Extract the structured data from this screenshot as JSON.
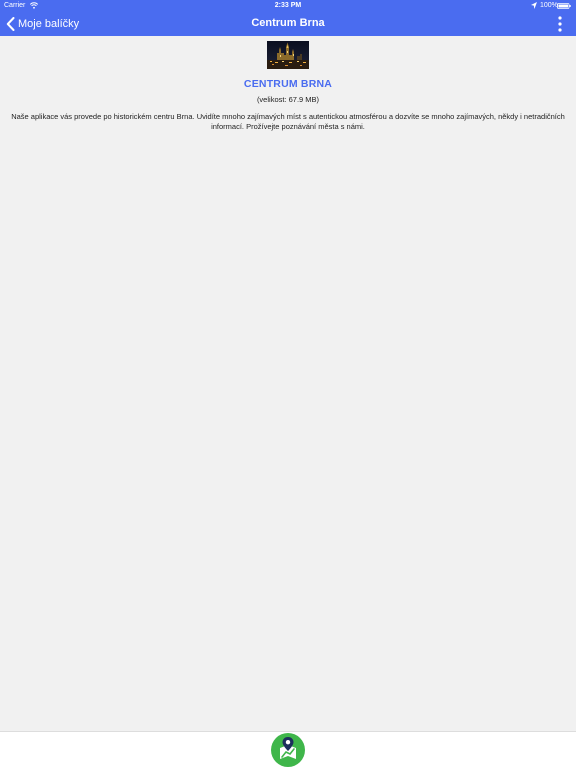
{
  "status_bar": {
    "carrier": "Carrier",
    "time": "2:33 PM",
    "battery": "100%",
    "icons": [
      "wifi-icon",
      "location-arrow-icon",
      "battery-icon"
    ]
  },
  "navbar": {
    "back_label": "Moje balíčky",
    "title": "Centrum Brna",
    "icons": [
      "chevron-left-icon",
      "more-vertical-icon"
    ]
  },
  "package": {
    "title": "CENTRUM BRNA",
    "size": "(velikost: 67.9 MB)",
    "description": "Naše aplikace vás provede po historickém centru Brna.  Uvidíte mnoho zajímavých míst s autentickou atmosférou a dozvíte se mnoho zajímavých, někdy i netradičních informací. Prožívejte poznávání města s námi."
  },
  "bottom_bar": {
    "icons": [
      "map-navigation-icon"
    ]
  },
  "colors": {
    "accent": "#4a6cf0",
    "background": "#f1f1f1",
    "map_button": "#3fb64a"
  }
}
